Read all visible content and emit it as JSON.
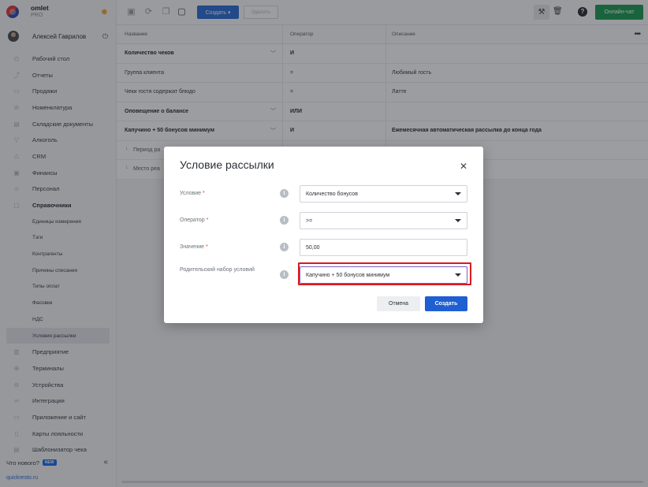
{
  "brand": {
    "name": "omlet",
    "plan": "PRO"
  },
  "user": {
    "name": "Алексей Гаврилов"
  },
  "sidebar": {
    "items": [
      {
        "label": "Рабочий стол",
        "icon": "dashboard-icon"
      },
      {
        "label": "Отчеты",
        "icon": "reports-icon"
      },
      {
        "label": "Продажи",
        "icon": "sales-icon"
      },
      {
        "label": "Номенклатура",
        "icon": "nomenclature-icon"
      },
      {
        "label": "Складские документы",
        "icon": "warehouse-icon"
      },
      {
        "label": "Алкоголь",
        "icon": "alcohol-icon"
      },
      {
        "label": "CRM",
        "icon": "crm-icon"
      },
      {
        "label": "Финансы",
        "icon": "finance-icon"
      },
      {
        "label": "Персонал",
        "icon": "staff-icon"
      },
      {
        "label": "Справочники",
        "icon": "reference-icon"
      }
    ],
    "sub_items": [
      "Единицы измерения",
      "Тэги",
      "Контрагенты",
      "Причины списания",
      "Типы оплат",
      "Фасовки",
      "НДС",
      "Условия рассылки"
    ],
    "items_after": [
      {
        "label": "Предприятие",
        "icon": "enterprise-icon"
      },
      {
        "label": "Терминалы",
        "icon": "terminals-icon"
      },
      {
        "label": "Устройства",
        "icon": "devices-icon"
      },
      {
        "label": "Интеграции",
        "icon": "integrations-icon"
      },
      {
        "label": "Приложение и сайт",
        "icon": "app-icon"
      },
      {
        "label": "Карты лояльности",
        "icon": "loyalty-icon"
      },
      {
        "label": "Шаблонизатор чека",
        "icon": "receipt-icon"
      }
    ],
    "whats_new": "Что нового?",
    "new_badge": "NEW",
    "site_link": "quickresto.ru"
  },
  "toolbar": {
    "create_label": "Создать ▾",
    "delete_label": "Удалить",
    "chat_label": "Онлайн-чат"
  },
  "table": {
    "headers": [
      "Название",
      "Оператор",
      "Описание"
    ],
    "rows": [
      {
        "name": "Количество чеков",
        "operator": "И",
        "description": ""
      },
      {
        "name": "Группа клиента",
        "operator": "=",
        "description": "Любимый гость"
      },
      {
        "name": "Чеки гостя содержат блюдо",
        "operator": "=",
        "description": "Латте"
      },
      {
        "name": "Оповещение о балансе",
        "operator": "ИЛИ",
        "description": ""
      },
      {
        "name": "Капучино + 50 бонусов минимум",
        "operator": "И",
        "description": "Ежемесячная автоматическая рассылка до конца года"
      },
      {
        "name": "Период ра",
        "operator": "",
        "description": ""
      },
      {
        "name": "Место реа",
        "operator": "",
        "description": ""
      }
    ]
  },
  "dialog": {
    "title": "Условие рассылки",
    "fields": [
      {
        "label": "Условие",
        "required": "*",
        "value": "Количество бонусов"
      },
      {
        "label": "Оператор",
        "required": "*",
        "value": ">="
      },
      {
        "label": "Значение",
        "required": "*",
        "value": "50,00"
      },
      {
        "label": "Родительский набор условий",
        "required": "",
        "value": "Капучино + 50 бонусов минимум"
      }
    ],
    "cancel_label": "Отмена",
    "create_label": "Создать"
  },
  "colors": {
    "accent": "#2d6ed6",
    "chat": "#1e9e55",
    "highlight": "#d9191f"
  }
}
